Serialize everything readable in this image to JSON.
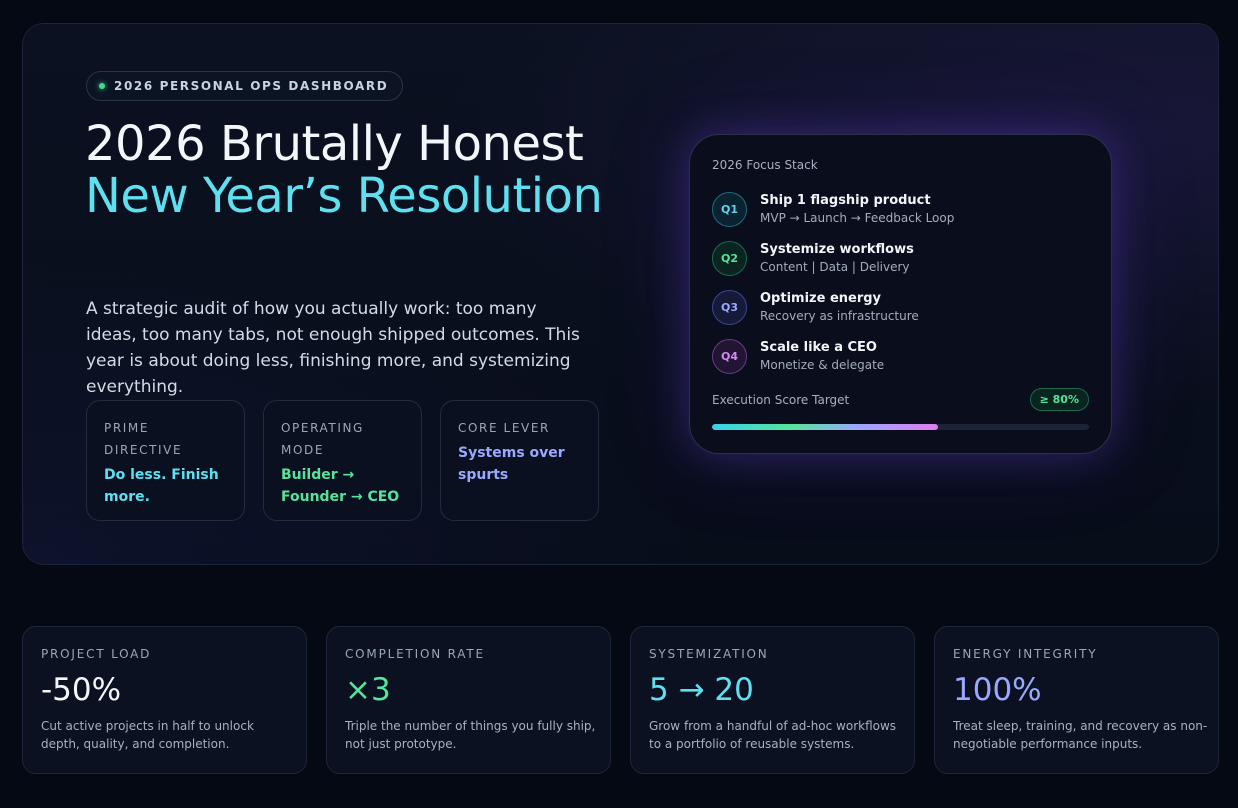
{
  "hero": {
    "pill": "2026 PERSONAL OPS DASHBOARD",
    "title_line1": "2026 Brutally Honest",
    "title_line2": "New Year’s Resolution",
    "subtitle": "A strategic audit of how you actually work: too many ideas, too many tabs, not enough shipped outcomes. This year is about doing less, finishing more, and systemizing everything.",
    "cards": [
      {
        "label": "PRIME DIRECTIVE",
        "value": "Do less. Finish more.",
        "color": "#5fe0f0"
      },
      {
        "label": "OPERATING MODE",
        "value": "Builder → Founder → CEO",
        "color": "#56e39b"
      },
      {
        "label": "CORE LEVER",
        "value": "Systems over spurts",
        "color": "#9aa8ff"
      }
    ]
  },
  "focus": {
    "heading": "2026 Focus Stack",
    "items": [
      {
        "badge": "Q1",
        "title": "Ship 1 flagship product",
        "sub": "MVP → Launch → Feedback Loop"
      },
      {
        "badge": "Q2",
        "title": "Systemize workflows",
        "sub": "Content | Data | Delivery"
      },
      {
        "badge": "Q3",
        "title": "Optimize energy",
        "sub": "Recovery as infrastructure"
      },
      {
        "badge": "Q4",
        "title": "Scale like a CEO",
        "sub": "Monetize & delegate"
      }
    ],
    "score_label": "Execution Score Target",
    "score_badge": "≥ 80%",
    "progress_fraction": 0.6
  },
  "stats": [
    {
      "label": "PROJECT LOAD",
      "value": "-50%",
      "desc": "Cut active projects in half to unlock depth, quality, and completion.",
      "color": "#f3f6fb"
    },
    {
      "label": "COMPLETION RATE",
      "value": "×3",
      "desc": "Triple the number of things you fully ship, not just prototype.",
      "color": "#56e39b"
    },
    {
      "label": "SYSTEMIZATION",
      "value": "5 → 20",
      "desc": "Grow from a handful of ad-hoc workflows to a portfolio of reusable systems.",
      "color": "#5fe0f0"
    },
    {
      "label": "ENERGY INTEGRITY",
      "value": "100%",
      "desc": "Treat sleep, training, and recovery as non-negotiable performance inputs.",
      "color": "#9aa8ff"
    }
  ]
}
